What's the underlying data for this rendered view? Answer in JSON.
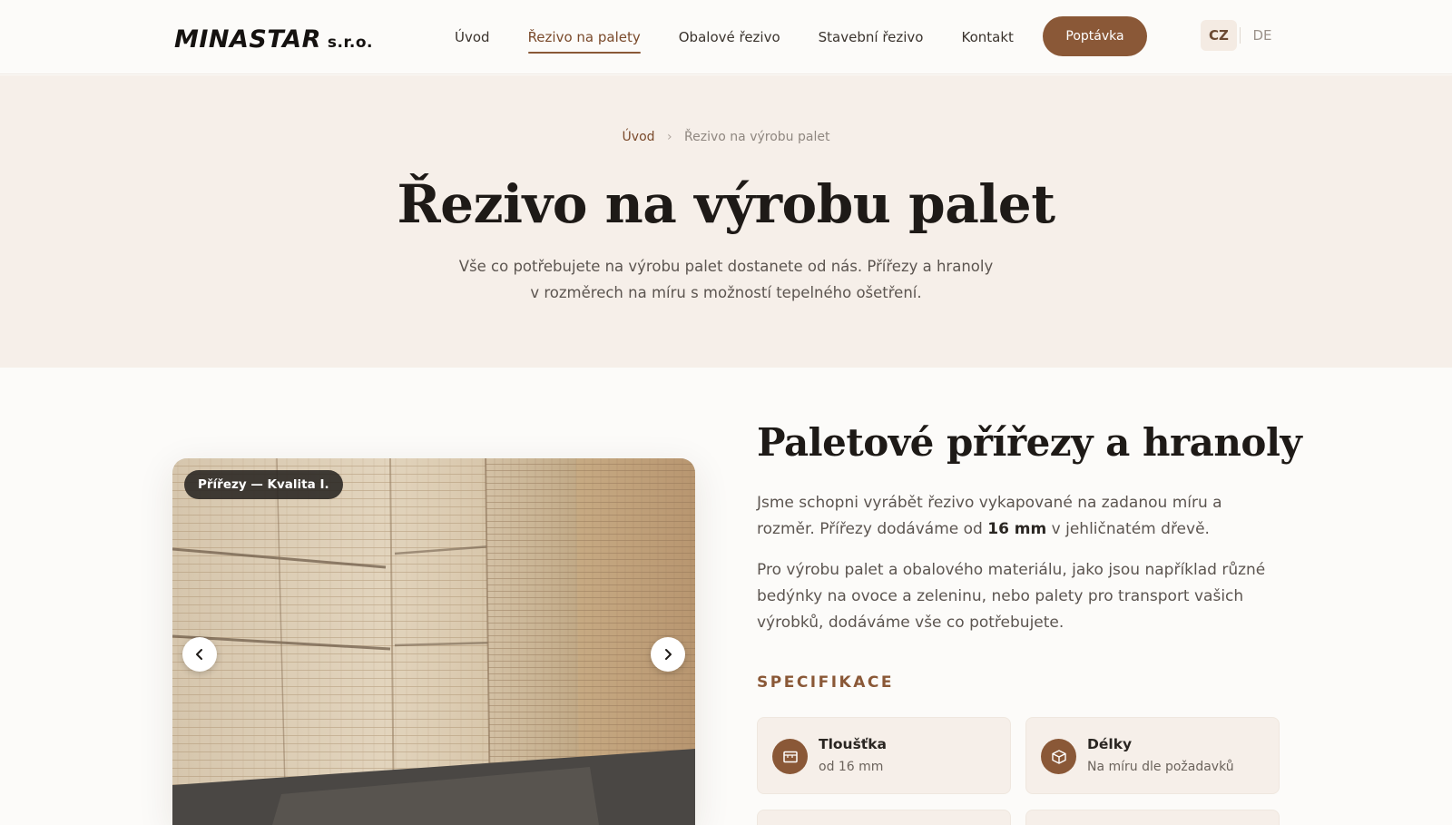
{
  "header": {
    "logo_main": "MINASTAR",
    "logo_sub": "s.r.o.",
    "nav": [
      "Úvod",
      "Řezivo na palety",
      "Obalové řezivo",
      "Stavební řezivo",
      "Kontakt"
    ],
    "active_nav": "Řezivo na palety",
    "cta_label": "Poptávka",
    "languages": [
      "CZ",
      "DE"
    ],
    "active_language": "CZ"
  },
  "hero": {
    "breadcrumb_home": "Úvod",
    "breadcrumb_separator": "›",
    "breadcrumb_current": "Řezivo na výrobu palet",
    "title": "Řezivo na výrobu palet",
    "subtitle": "Vše co potřebujete na výrobu palet dostanete od nás. Přířezy a hranoly v rozměrech na míru s možností tepelného ošetření."
  },
  "gallery": {
    "badge": "Přířezy — Kvalita I.",
    "prev_icon": "chevron-left-icon",
    "next_icon": "chevron-right-icon"
  },
  "content": {
    "section_title": "Paletové přířezy a hranoly",
    "para1_a": "Jsme schopni vyrábět řezivo vykapované na zadanou míru a rozměr. Přířezy dodáváme od ",
    "para1_strong": "16 mm",
    "para1_b": " v jehličnatém dřevě.",
    "para2": "Pro výrobu palet a obalového materiálu, jako jsou například různé bedýnky na ovoce a zeleninu, nebo palety pro transport vašich výrobků, dodáváme vše co potřebujete.",
    "spec_heading": "SPECIFIKACE",
    "specs": [
      {
        "title": "Tloušťka",
        "value": "od 16 mm",
        "icon": "ruler-box-icon"
      },
      {
        "title": "Délky",
        "value": "Na míru dle požadavků",
        "icon": "cube-icon"
      }
    ]
  },
  "colors": {
    "accent": "#8a5837",
    "hero_bg": "#f6efe9",
    "page_bg": "#fcfbf9",
    "text_dark": "#1e1a17"
  }
}
